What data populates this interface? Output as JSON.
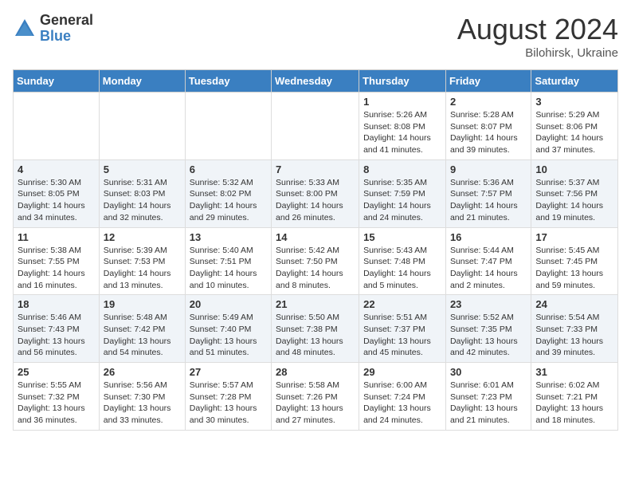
{
  "logo": {
    "general": "General",
    "blue": "Blue"
  },
  "title": {
    "month_year": "August 2024",
    "location": "Bilohirsk, Ukraine"
  },
  "days_of_week": [
    "Sunday",
    "Monday",
    "Tuesday",
    "Wednesday",
    "Thursday",
    "Friday",
    "Saturday"
  ],
  "weeks": [
    [
      {
        "day": "",
        "sunrise": "",
        "sunset": "",
        "daylight": ""
      },
      {
        "day": "",
        "sunrise": "",
        "sunset": "",
        "daylight": ""
      },
      {
        "day": "",
        "sunrise": "",
        "sunset": "",
        "daylight": ""
      },
      {
        "day": "",
        "sunrise": "",
        "sunset": "",
        "daylight": ""
      },
      {
        "day": "1",
        "sunrise": "Sunrise: 5:26 AM",
        "sunset": "Sunset: 8:08 PM",
        "daylight": "Daylight: 14 hours and 41 minutes."
      },
      {
        "day": "2",
        "sunrise": "Sunrise: 5:28 AM",
        "sunset": "Sunset: 8:07 PM",
        "daylight": "Daylight: 14 hours and 39 minutes."
      },
      {
        "day": "3",
        "sunrise": "Sunrise: 5:29 AM",
        "sunset": "Sunset: 8:06 PM",
        "daylight": "Daylight: 14 hours and 37 minutes."
      }
    ],
    [
      {
        "day": "4",
        "sunrise": "Sunrise: 5:30 AM",
        "sunset": "Sunset: 8:05 PM",
        "daylight": "Daylight: 14 hours and 34 minutes."
      },
      {
        "day": "5",
        "sunrise": "Sunrise: 5:31 AM",
        "sunset": "Sunset: 8:03 PM",
        "daylight": "Daylight: 14 hours and 32 minutes."
      },
      {
        "day": "6",
        "sunrise": "Sunrise: 5:32 AM",
        "sunset": "Sunset: 8:02 PM",
        "daylight": "Daylight: 14 hours and 29 minutes."
      },
      {
        "day": "7",
        "sunrise": "Sunrise: 5:33 AM",
        "sunset": "Sunset: 8:00 PM",
        "daylight": "Daylight: 14 hours and 26 minutes."
      },
      {
        "day": "8",
        "sunrise": "Sunrise: 5:35 AM",
        "sunset": "Sunset: 7:59 PM",
        "daylight": "Daylight: 14 hours and 24 minutes."
      },
      {
        "day": "9",
        "sunrise": "Sunrise: 5:36 AM",
        "sunset": "Sunset: 7:57 PM",
        "daylight": "Daylight: 14 hours and 21 minutes."
      },
      {
        "day": "10",
        "sunrise": "Sunrise: 5:37 AM",
        "sunset": "Sunset: 7:56 PM",
        "daylight": "Daylight: 14 hours and 19 minutes."
      }
    ],
    [
      {
        "day": "11",
        "sunrise": "Sunrise: 5:38 AM",
        "sunset": "Sunset: 7:55 PM",
        "daylight": "Daylight: 14 hours and 16 minutes."
      },
      {
        "day": "12",
        "sunrise": "Sunrise: 5:39 AM",
        "sunset": "Sunset: 7:53 PM",
        "daylight": "Daylight: 14 hours and 13 minutes."
      },
      {
        "day": "13",
        "sunrise": "Sunrise: 5:40 AM",
        "sunset": "Sunset: 7:51 PM",
        "daylight": "Daylight: 14 hours and 10 minutes."
      },
      {
        "day": "14",
        "sunrise": "Sunrise: 5:42 AM",
        "sunset": "Sunset: 7:50 PM",
        "daylight": "Daylight: 14 hours and 8 minutes."
      },
      {
        "day": "15",
        "sunrise": "Sunrise: 5:43 AM",
        "sunset": "Sunset: 7:48 PM",
        "daylight": "Daylight: 14 hours and 5 minutes."
      },
      {
        "day": "16",
        "sunrise": "Sunrise: 5:44 AM",
        "sunset": "Sunset: 7:47 PM",
        "daylight": "Daylight: 14 hours and 2 minutes."
      },
      {
        "day": "17",
        "sunrise": "Sunrise: 5:45 AM",
        "sunset": "Sunset: 7:45 PM",
        "daylight": "Daylight: 13 hours and 59 minutes."
      }
    ],
    [
      {
        "day": "18",
        "sunrise": "Sunrise: 5:46 AM",
        "sunset": "Sunset: 7:43 PM",
        "daylight": "Daylight: 13 hours and 56 minutes."
      },
      {
        "day": "19",
        "sunrise": "Sunrise: 5:48 AM",
        "sunset": "Sunset: 7:42 PM",
        "daylight": "Daylight: 13 hours and 54 minutes."
      },
      {
        "day": "20",
        "sunrise": "Sunrise: 5:49 AM",
        "sunset": "Sunset: 7:40 PM",
        "daylight": "Daylight: 13 hours and 51 minutes."
      },
      {
        "day": "21",
        "sunrise": "Sunrise: 5:50 AM",
        "sunset": "Sunset: 7:38 PM",
        "daylight": "Daylight: 13 hours and 48 minutes."
      },
      {
        "day": "22",
        "sunrise": "Sunrise: 5:51 AM",
        "sunset": "Sunset: 7:37 PM",
        "daylight": "Daylight: 13 hours and 45 minutes."
      },
      {
        "day": "23",
        "sunrise": "Sunrise: 5:52 AM",
        "sunset": "Sunset: 7:35 PM",
        "daylight": "Daylight: 13 hours and 42 minutes."
      },
      {
        "day": "24",
        "sunrise": "Sunrise: 5:54 AM",
        "sunset": "Sunset: 7:33 PM",
        "daylight": "Daylight: 13 hours and 39 minutes."
      }
    ],
    [
      {
        "day": "25",
        "sunrise": "Sunrise: 5:55 AM",
        "sunset": "Sunset: 7:32 PM",
        "daylight": "Daylight: 13 hours and 36 minutes."
      },
      {
        "day": "26",
        "sunrise": "Sunrise: 5:56 AM",
        "sunset": "Sunset: 7:30 PM",
        "daylight": "Daylight: 13 hours and 33 minutes."
      },
      {
        "day": "27",
        "sunrise": "Sunrise: 5:57 AM",
        "sunset": "Sunset: 7:28 PM",
        "daylight": "Daylight: 13 hours and 30 minutes."
      },
      {
        "day": "28",
        "sunrise": "Sunrise: 5:58 AM",
        "sunset": "Sunset: 7:26 PM",
        "daylight": "Daylight: 13 hours and 27 minutes."
      },
      {
        "day": "29",
        "sunrise": "Sunrise: 6:00 AM",
        "sunset": "Sunset: 7:24 PM",
        "daylight": "Daylight: 13 hours and 24 minutes."
      },
      {
        "day": "30",
        "sunrise": "Sunrise: 6:01 AM",
        "sunset": "Sunset: 7:23 PM",
        "daylight": "Daylight: 13 hours and 21 minutes."
      },
      {
        "day": "31",
        "sunrise": "Sunrise: 6:02 AM",
        "sunset": "Sunset: 7:21 PM",
        "daylight": "Daylight: 13 hours and 18 minutes."
      }
    ]
  ]
}
